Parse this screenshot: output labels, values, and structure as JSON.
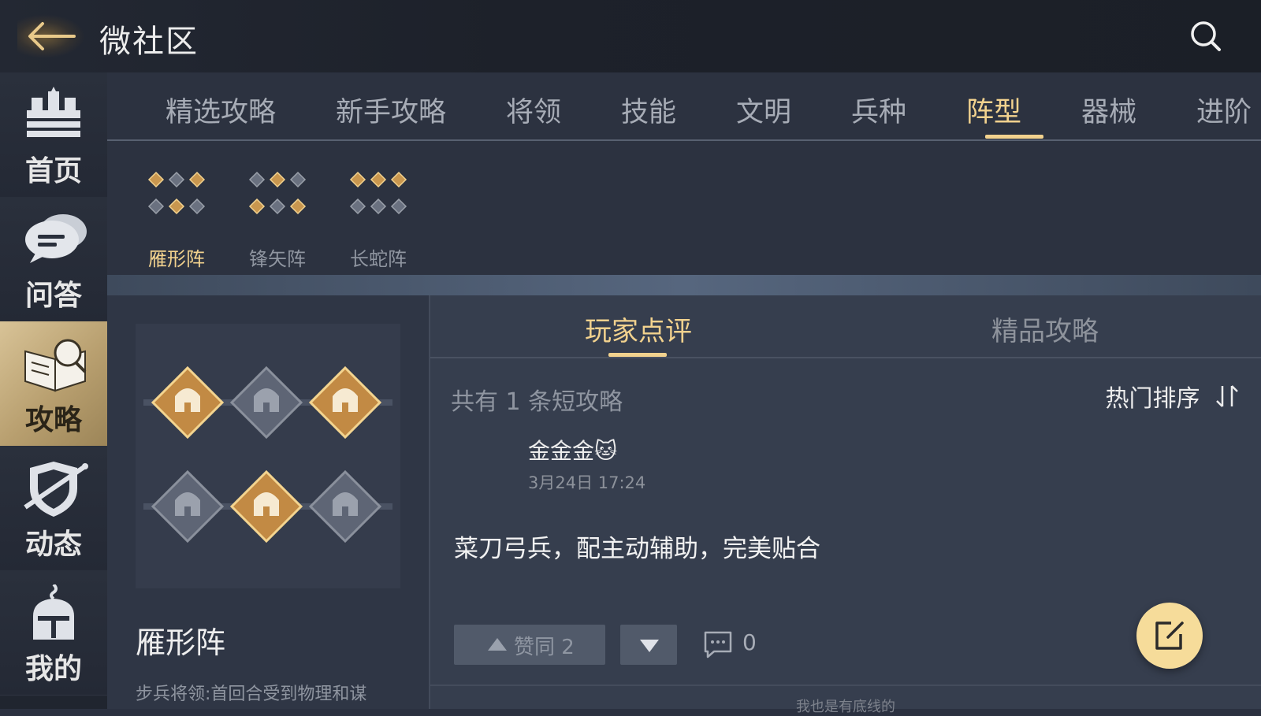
{
  "header": {
    "title": "微社区",
    "back_icon": "arrow-left-icon",
    "search_icon": "search-icon"
  },
  "sidebar": {
    "items": [
      {
        "label": "首页",
        "icon": "castle-icon",
        "active": false
      },
      {
        "label": "问答",
        "icon": "chat-bubble-icon",
        "active": false
      },
      {
        "label": "攻略",
        "icon": "guidebook-icon",
        "active": true
      },
      {
        "label": "动态",
        "icon": "shield-sword-icon",
        "active": false
      },
      {
        "label": "我的",
        "icon": "knight-helmet-icon",
        "active": false
      }
    ]
  },
  "tabs": [
    "精选攻略",
    "新手攻略",
    "将领",
    "技能",
    "文明",
    "兵种",
    "阵型",
    "器械",
    "进阶"
  ],
  "active_tab": "阵型",
  "formations": [
    {
      "label": "雁形阵",
      "active": true
    },
    {
      "label": "锋矢阵",
      "active": false
    },
    {
      "label": "长蛇阵",
      "active": false
    }
  ],
  "detail": {
    "name": "雁形阵",
    "description": "步兵将领:首回合受到物理和谋"
  },
  "review": {
    "tabs": [
      "玩家点评",
      "精品攻略"
    ],
    "active_tab": "玩家点评",
    "count_text": "共有 1 条短攻略",
    "sort_label": "热门排序",
    "post": {
      "author": "金金金🐱",
      "time": "3月24日 17:24",
      "body": "菜刀弓兵，配主动辅助，完美贴合",
      "upvote_label": "赞同 2",
      "comment_count": "0"
    },
    "footer_hint": "我也是有底线的"
  },
  "colors": {
    "accent": "#f2d28e",
    "compose": "#f6dc9a",
    "background": "#2b3140"
  }
}
